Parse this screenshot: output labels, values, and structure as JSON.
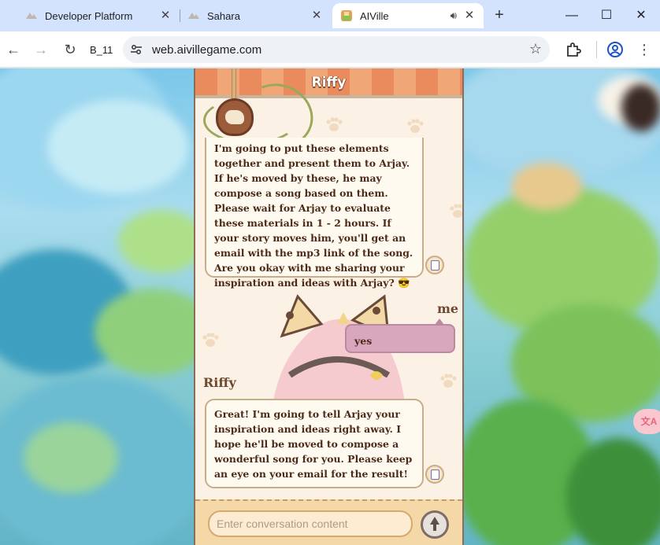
{
  "browser": {
    "tabs": [
      {
        "title": "Developer Platform",
        "active": false
      },
      {
        "title": "Sahara",
        "active": false
      },
      {
        "title": "AIVille",
        "active": true
      }
    ],
    "profile_label": "B_11",
    "url": "web.aivillegame.com",
    "accent": "#d3e3fd"
  },
  "game": {
    "header_title": "Riffy",
    "messages": [
      {
        "speaker": "",
        "text": "I'm going to put these elements together and present them to Arjay. If he's moved by these, he may compose a song based on them. Please wait for Arjay to evaluate these materials in 1 - 2 hours. If your story moves him, you'll get an email with the mp3 link of the song. Are you okay with me sharing your inspiration and ideas with Arjay? 😎"
      },
      {
        "speaker": "me",
        "text": "yes"
      },
      {
        "speaker": "Riffy",
        "text": "Great! I'm going to tell Arjay your inspiration and ideas right away. I hope he'll be moved to compose a wonderful song for you. Please keep an eye on your email for the result!"
      }
    ],
    "input": {
      "placeholder": "Enter conversation content"
    },
    "side_tool_label": "文A",
    "colors": {
      "header": "#e98b5c",
      "user_bubble": "#d9a7bd",
      "panel": "#fbf1e4"
    }
  }
}
